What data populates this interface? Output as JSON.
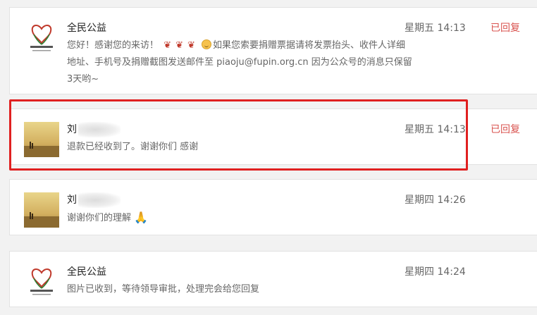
{
  "conversations": [
    {
      "name": "全民公益",
      "message_parts": {
        "line1_a": "您好！感谢您的来访！",
        "line1_b": "如果您索要捐赠票据请将发票抬头、收件人详细地址、手机号及捐赠截图发送邮件至 piaoju@fupin.org.cn 因为公众号的消息只保留3天哟~"
      },
      "time": "星期五 14:13",
      "status": "已回复",
      "avatar": "charity-logo-icon"
    },
    {
      "name": "刘",
      "message": "退款已经收到了。谢谢你们 感谢",
      "time": "星期五 14:13",
      "status": "已回复",
      "avatar": "landscape-photo-avatar",
      "highlighted": true
    },
    {
      "name": "刘",
      "message": "谢谢你们的理解",
      "time": "星期四 14:26",
      "status": "",
      "avatar": "landscape-photo-avatar"
    },
    {
      "name": "全民公益",
      "message": "图片已收到，等待领导审批，处理完会给您回复",
      "time": "星期四 14:24",
      "status": "",
      "avatar": "charity-logo-icon"
    }
  ],
  "colors": {
    "highlight_border": "#e02020",
    "status_text": "#d9534f",
    "background": "#f2f2f2"
  }
}
